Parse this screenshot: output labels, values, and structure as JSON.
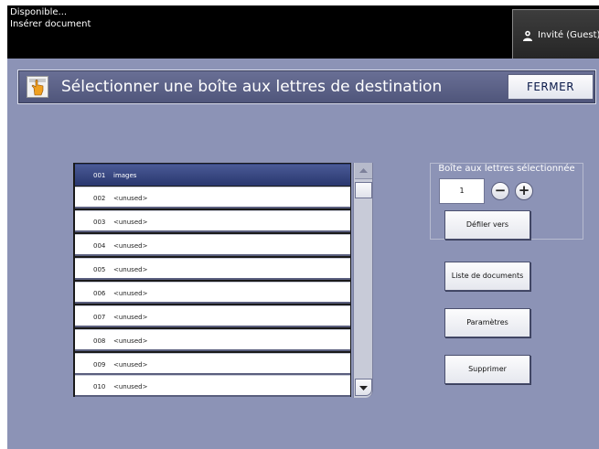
{
  "status": {
    "line1": "Disponible...",
    "line2": "Insérer document"
  },
  "guest_button": {
    "label": "Invité (Guest)",
    "icon": "user-icon"
  },
  "titlebar": {
    "title": "Sélectionner une boîte aux lettres de destination",
    "icon": "hand-pointer-icon",
    "close_label": "FERMER"
  },
  "mailboxes": [
    {
      "number": "001",
      "name": "images",
      "selected": true
    },
    {
      "number": "002",
      "name": "<unused>",
      "selected": false
    },
    {
      "number": "003",
      "name": "<unused>",
      "selected": false
    },
    {
      "number": "004",
      "name": "<unused>",
      "selected": false
    },
    {
      "number": "005",
      "name": "<unused>",
      "selected": false
    },
    {
      "number": "006",
      "name": "<unused>",
      "selected": false
    },
    {
      "number": "007",
      "name": "<unused>",
      "selected": false
    },
    {
      "number": "008",
      "name": "<unused>",
      "selected": false
    },
    {
      "number": "009",
      "name": "<unused>",
      "selected": false
    },
    {
      "number": "010",
      "name": "<unused>",
      "selected": false
    }
  ],
  "selection_panel": {
    "heading": "Boîte aux lettres sélectionnée",
    "value": "1",
    "minus_label": "−",
    "plus_label": "+",
    "scroll_to_label": "Défiler vers"
  },
  "actions": {
    "documents_label": "Liste de documents",
    "settings_label": "Paramètres",
    "delete_label": "Supprimer"
  },
  "colors": {
    "background": "#8c93b6",
    "titlebar": "#5a6088",
    "selected_row": "#3a4884",
    "status_bar": "#000000"
  }
}
